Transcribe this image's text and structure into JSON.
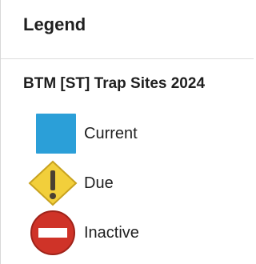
{
  "legend": {
    "title": "Legend",
    "layer_title": "BTM [ST] Trap Sites 2024",
    "items": [
      {
        "label": "Current",
        "icon": "blue-square-icon",
        "color": "#2b9fd8"
      },
      {
        "label": "Due",
        "icon": "yellow-warning-diamond-icon",
        "color": "#f2cf3b"
      },
      {
        "label": "Inactive",
        "icon": "red-no-entry-icon",
        "color": "#cf3328"
      }
    ]
  }
}
